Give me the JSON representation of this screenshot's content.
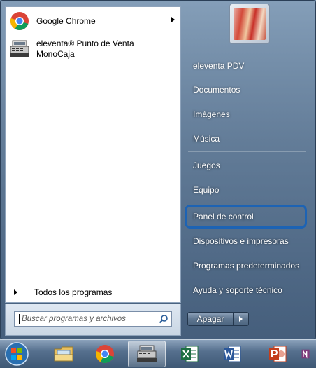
{
  "left_pane": {
    "programs": [
      {
        "label": "Google Chrome",
        "icon": "chrome-icon",
        "has_submenu": true
      },
      {
        "label": "eleventa® Punto de Venta MonoCaja",
        "icon": "cash-register-icon",
        "has_submenu": false
      }
    ],
    "all_programs_label": "Todos los programas",
    "search_placeholder": "Buscar programas y archivos"
  },
  "right_pane": {
    "items": [
      {
        "label": "eleventa PDV"
      },
      {
        "label": "Documentos"
      },
      {
        "label": "Imágenes"
      },
      {
        "label": "Música"
      },
      {
        "label": "Juegos"
      },
      {
        "label": "Equipo"
      },
      {
        "label": "Panel de control",
        "highlighted": true
      },
      {
        "label": "Dispositivos e impresoras"
      },
      {
        "label": "Programas predeterminados"
      },
      {
        "label": "Ayuda y soporte técnico"
      }
    ],
    "shutdown_label": "Apagar"
  },
  "taskbar": {
    "items": [
      {
        "icon": "windows-start-icon"
      },
      {
        "icon": "file-explorer-icon"
      },
      {
        "icon": "chrome-icon"
      },
      {
        "icon": "cash-register-icon",
        "active": true
      },
      {
        "icon": "excel-icon"
      },
      {
        "icon": "word-icon"
      },
      {
        "icon": "powerpoint-icon"
      },
      {
        "icon": "onenote-icon"
      }
    ]
  },
  "colors": {
    "highlight_ring": "#1d63b4",
    "menu_pane": "#ffffff"
  }
}
